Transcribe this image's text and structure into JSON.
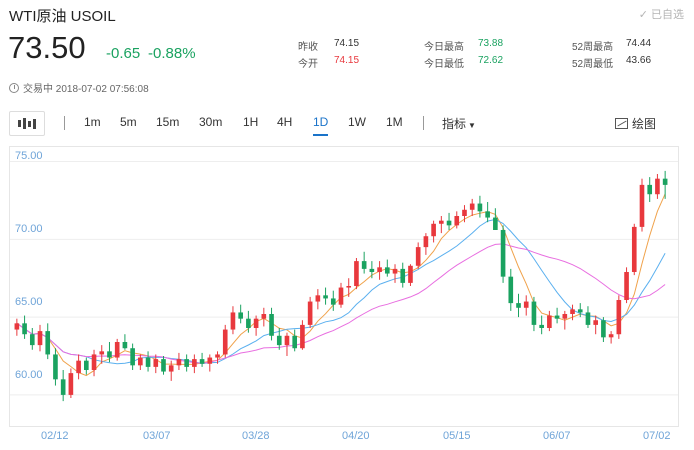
{
  "header": {
    "title": "WTI原油  USOIL",
    "watchlist_label": "已自选",
    "price": "73.50",
    "change": "-0.65",
    "change_pct": "-0.88%",
    "status": "交易中 2018-07-02 07:56:08"
  },
  "stats": [
    {
      "label": "昨收",
      "value": "74.15",
      "color": "#333333"
    },
    {
      "label": "今开",
      "value": "74.15",
      "color": "#e8383d"
    },
    {
      "label": "今日最高",
      "value": "73.88",
      "color": "#1aa260"
    },
    {
      "label": "今日最低",
      "value": "72.62",
      "color": "#1aa260"
    },
    {
      "label": "52周最高",
      "value": "74.44",
      "color": "#333333"
    },
    {
      "label": "52周最低",
      "value": "43.66",
      "color": "#333333"
    }
  ],
  "toolbar": {
    "timeframes": [
      "1m",
      "5m",
      "15m",
      "30m",
      "1H",
      "4H",
      "1D",
      "1W",
      "1M"
    ],
    "active": "1D",
    "indicator_label": "指标",
    "draw_label": "绘图"
  },
  "colors": {
    "up": "#e8383d",
    "down": "#1aa260",
    "ma_short": "#f0a24b",
    "ma_mid": "#5bb0ef",
    "ma_long": "#e86ee0",
    "axis": "#6fa4d8"
  },
  "chart_data": {
    "type": "candlestick",
    "y_ticks": [
      "75.00",
      "70.00",
      "65.00",
      "60.00"
    ],
    "ylim": [
      58.0,
      76.0
    ],
    "x_ticks": [
      "02/12",
      "03/07",
      "03/28",
      "04/20",
      "05/15",
      "06/07",
      "07/02"
    ],
    "candles": [
      [
        64.2,
        64.9,
        63.8,
        64.6
      ],
      [
        64.6,
        65.1,
        63.6,
        63.9
      ],
      [
        63.9,
        64.3,
        62.9,
        63.2
      ],
      [
        63.2,
        64.5,
        62.8,
        64.1
      ],
      [
        64.1,
        64.6,
        62.3,
        62.6
      ],
      [
        62.6,
        63.0,
        60.6,
        61.0
      ],
      [
        61.0,
        61.6,
        59.6,
        60.0
      ],
      [
        60.0,
        61.7,
        59.8,
        61.4
      ],
      [
        61.4,
        62.6,
        61.0,
        62.2
      ],
      [
        62.2,
        62.4,
        61.3,
        61.6
      ],
      [
        61.6,
        62.9,
        61.2,
        62.6
      ],
      [
        62.6,
        63.2,
        62.0,
        62.8
      ],
      [
        62.8,
        63.4,
        62.1,
        62.4
      ],
      [
        62.4,
        63.6,
        62.2,
        63.4
      ],
      [
        63.4,
        63.9,
        62.9,
        63.0
      ],
      [
        63.0,
        63.3,
        61.6,
        61.9
      ],
      [
        61.9,
        62.6,
        61.6,
        62.4
      ],
      [
        62.4,
        62.8,
        61.5,
        61.8
      ],
      [
        61.8,
        62.6,
        61.4,
        62.3
      ],
      [
        62.3,
        62.5,
        61.3,
        61.5
      ],
      [
        61.5,
        62.2,
        60.9,
        61.9
      ],
      [
        61.9,
        62.7,
        61.6,
        62.3
      ],
      [
        62.3,
        62.6,
        61.5,
        61.8
      ],
      [
        61.8,
        62.6,
        61.4,
        62.3
      ],
      [
        62.3,
        62.7,
        61.8,
        62.0
      ],
      [
        62.0,
        62.6,
        61.5,
        62.4
      ],
      [
        62.4,
        62.8,
        62.0,
        62.6
      ],
      [
        62.6,
        64.5,
        62.4,
        64.2
      ],
      [
        64.2,
        65.7,
        63.9,
        65.3
      ],
      [
        65.3,
        65.8,
        64.6,
        64.9
      ],
      [
        64.9,
        65.4,
        64.0,
        64.3
      ],
      [
        64.3,
        65.1,
        63.8,
        64.9
      ],
      [
        64.9,
        65.6,
        64.4,
        65.2
      ],
      [
        65.2,
        65.6,
        63.5,
        63.8
      ],
      [
        63.8,
        64.3,
        62.9,
        63.2
      ],
      [
        63.2,
        64.0,
        62.5,
        63.8
      ],
      [
        63.8,
        64.2,
        62.8,
        63.0
      ],
      [
        63.0,
        64.8,
        62.9,
        64.5
      ],
      [
        64.5,
        66.3,
        64.3,
        66.0
      ],
      [
        66.0,
        66.8,
        65.5,
        66.4
      ],
      [
        66.4,
        66.9,
        65.8,
        66.2
      ],
      [
        66.2,
        66.7,
        65.4,
        65.8
      ],
      [
        65.8,
        67.2,
        65.6,
        66.9
      ],
      [
        66.9,
        67.5,
        66.3,
        67.0
      ],
      [
        67.0,
        68.8,
        66.8,
        68.6
      ],
      [
        68.6,
        69.2,
        67.8,
        68.1
      ],
      [
        68.1,
        68.6,
        67.5,
        67.9
      ],
      [
        67.9,
        68.6,
        67.4,
        68.2
      ],
      [
        68.2,
        68.7,
        67.6,
        67.8
      ],
      [
        67.8,
        68.4,
        67.2,
        68.1
      ],
      [
        68.1,
        68.5,
        66.9,
        67.2
      ],
      [
        67.2,
        68.4,
        67.0,
        68.3
      ],
      [
        68.3,
        69.8,
        68.1,
        69.5
      ],
      [
        69.5,
        70.4,
        69.0,
        70.2
      ],
      [
        70.2,
        71.2,
        69.8,
        71.0
      ],
      [
        71.0,
        71.5,
        70.4,
        71.2
      ],
      [
        71.2,
        71.7,
        70.6,
        70.9
      ],
      [
        70.9,
        71.8,
        70.7,
        71.5
      ],
      [
        71.5,
        72.2,
        71.1,
        71.9
      ],
      [
        71.9,
        72.6,
        71.5,
        72.3
      ],
      [
        72.3,
        72.8,
        71.4,
        71.8
      ],
      [
        71.8,
        72.4,
        71.1,
        71.4
      ],
      [
        71.4,
        72.0,
        70.8,
        70.6
      ],
      [
        70.6,
        70.9,
        67.2,
        67.6
      ],
      [
        67.6,
        68.1,
        65.4,
        65.9
      ],
      [
        65.9,
        66.5,
        65.0,
        65.6
      ],
      [
        65.6,
        66.4,
        65.1,
        66.0
      ],
      [
        66.0,
        66.3,
        64.1,
        64.5
      ],
      [
        64.5,
        65.1,
        63.9,
        64.3
      ],
      [
        64.3,
        65.4,
        64.1,
        65.1
      ],
      [
        65.1,
        65.6,
        64.6,
        64.9
      ],
      [
        64.9,
        65.4,
        64.2,
        65.2
      ],
      [
        65.2,
        65.8,
        64.8,
        65.5
      ],
      [
        65.5,
        65.9,
        65.0,
        65.3
      ],
      [
        65.3,
        65.7,
        64.3,
        64.5
      ],
      [
        64.5,
        65.1,
        63.9,
        64.8
      ],
      [
        64.8,
        65.0,
        63.4,
        63.7
      ],
      [
        63.7,
        64.1,
        63.3,
        63.9
      ],
      [
        63.9,
        66.4,
        63.6,
        66.1
      ],
      [
        66.1,
        68.2,
        65.9,
        67.9
      ],
      [
        67.9,
        71.0,
        67.7,
        70.8
      ],
      [
        70.8,
        73.9,
        70.5,
        73.5
      ],
      [
        73.5,
        74.0,
        72.4,
        72.9
      ],
      [
        72.9,
        74.2,
        72.6,
        73.9
      ],
      [
        73.9,
        74.4,
        72.6,
        73.5
      ]
    ],
    "moving_averages": [
      "MA5",
      "MA10",
      "MA20"
    ]
  }
}
